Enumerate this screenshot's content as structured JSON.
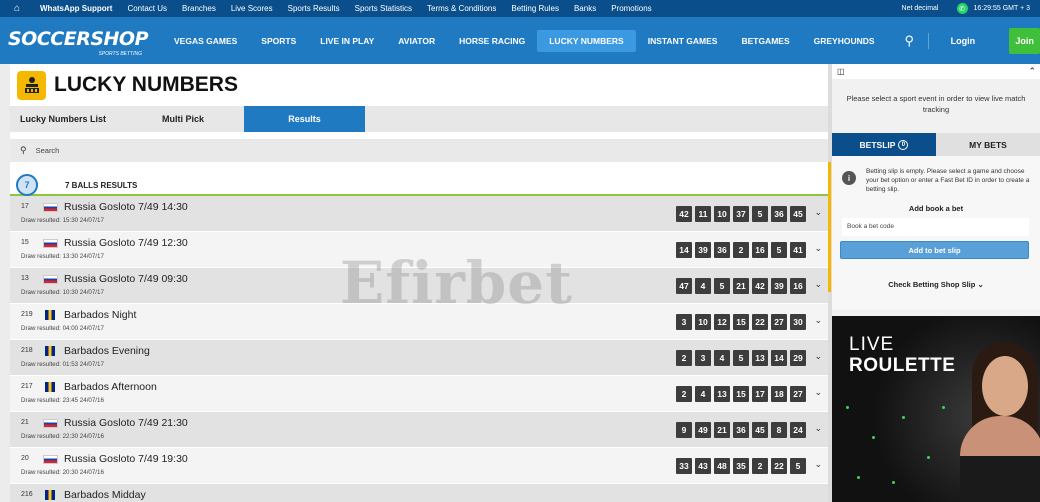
{
  "topbar": {
    "links": [
      "WhatsApp Support",
      "Contact Us",
      "Branches",
      "Live Scores",
      "Sports Results",
      "Sports Statistics",
      "Terms & Conditions",
      "Betting Rules",
      "Banks",
      "Promotions"
    ],
    "odds_format": "Net decimal",
    "time": "16:29:55 GMT + 3"
  },
  "nav": {
    "logo": "SOCCERSHOP",
    "logo_sub": "SPORTS BETTING",
    "items": [
      "VEGAS GAMES",
      "SPORTS",
      "LIVE IN PLAY",
      "AVIATOR",
      "HORSE RACING",
      "LUCKY NUMBERS",
      "INSTANT GAMES",
      "BETGAMES",
      "GREYHOUNDS"
    ],
    "active_item": "LUCKY NUMBERS",
    "login": "Login",
    "join": "Join"
  },
  "page": {
    "title": "LUCKY NUMBERS",
    "tabs": [
      "Lucky Numbers List",
      "Multi Pick",
      "Results"
    ],
    "active_tab": "Results",
    "search_placeholder": "Search",
    "results_header": "7 BALLS RESULTS",
    "ball_icon_number": "7",
    "watermark": "Efirbet"
  },
  "results": [
    {
      "num": "17",
      "country": "ru",
      "name": "Russia Gosloto 7/49 14:30",
      "draw": "Draw resulted: 15:30 24/07/17",
      "balls": [
        "42",
        "11",
        "10",
        "37",
        "5",
        "36",
        "45"
      ]
    },
    {
      "num": "15",
      "country": "ru",
      "name": "Russia Gosloto 7/49 12:30",
      "draw": "Draw resulted: 13:30 24/07/17",
      "balls": [
        "14",
        "39",
        "36",
        "2",
        "16",
        "5",
        "41"
      ]
    },
    {
      "num": "13",
      "country": "ru",
      "name": "Russia Gosloto 7/49 09:30",
      "draw": "Draw resulted: 10:30 24/07/17",
      "balls": [
        "47",
        "4",
        "5",
        "21",
        "42",
        "39",
        "16"
      ]
    },
    {
      "num": "219",
      "country": "bb",
      "name": "Barbados Night",
      "draw": "Draw resulted: 04:00 24/07/17",
      "balls": [
        "3",
        "10",
        "12",
        "15",
        "22",
        "27",
        "30"
      ]
    },
    {
      "num": "218",
      "country": "bb",
      "name": "Barbados Evening",
      "draw": "Draw resulted: 01:53 24/07/17",
      "balls": [
        "2",
        "3",
        "4",
        "5",
        "13",
        "14",
        "29"
      ]
    },
    {
      "num": "217",
      "country": "bb",
      "name": "Barbados Afternoon",
      "draw": "Draw resulted: 23:45 24/07/16",
      "balls": [
        "2",
        "4",
        "13",
        "15",
        "17",
        "18",
        "27"
      ]
    },
    {
      "num": "21",
      "country": "ru",
      "name": "Russia Gosloto 7/49 21:30",
      "draw": "Draw resulted: 22:30 24/07/16",
      "balls": [
        "9",
        "49",
        "21",
        "36",
        "45",
        "8",
        "24"
      ]
    },
    {
      "num": "20",
      "country": "ru",
      "name": "Russia Gosloto 7/49 19:30",
      "draw": "Draw resulted: 20:30 24/07/16",
      "balls": [
        "33",
        "43",
        "48",
        "35",
        "2",
        "22",
        "5"
      ]
    },
    {
      "num": "216",
      "country": "bb",
      "name": "Barbados Midday",
      "draw": "",
      "balls": []
    }
  ],
  "sidebar": {
    "tracker_message": "Please select a sport event in order to view live match tracking",
    "betslip_tab": "BETSLIP",
    "betslip_count": "0",
    "mybets_tab": "MY BETS",
    "empty_message": "Betting slip is empty. Please select a game and choose your bet option or enter a Fast Bet ID in order to create a betting slip.",
    "book_heading": "Add book a bet",
    "book_placeholder": "Book a bet code",
    "add_button": "Add to bet slip",
    "check_link": "Check Betting Shop Slip",
    "promo_line1": "LIVE",
    "promo_line2": "ROULETTE"
  }
}
